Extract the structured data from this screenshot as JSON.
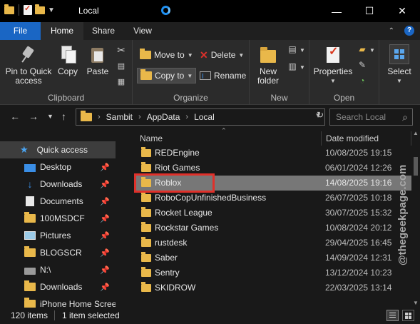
{
  "window": {
    "title": "Local",
    "minimize_glyph": "—",
    "maximize_glyph": "☐",
    "close_glyph": "✕"
  },
  "ribbon_tabs": [
    {
      "label": "File"
    },
    {
      "label": "Home"
    },
    {
      "label": "Share"
    },
    {
      "label": "View"
    }
  ],
  "ribbon": {
    "clipboard": {
      "group_label": "Clipboard",
      "pin_label_1": "Pin to Quick",
      "pin_label_2": "access",
      "copy_label": "Copy",
      "paste_label": "Paste"
    },
    "organize": {
      "group_label": "Organize",
      "move_to": "Move to",
      "copy_to": "Copy to",
      "delete": "Delete",
      "rename": "Rename"
    },
    "new": {
      "group_label": "New",
      "new_folder_1": "New",
      "new_folder_2": "folder"
    },
    "open": {
      "group_label": "Open",
      "properties": "Properties"
    },
    "select": {
      "label": "Select"
    }
  },
  "address": {
    "segments": [
      "Sambit",
      "AppData",
      "Local"
    ],
    "search_placeholder": "Search Local"
  },
  "nav_pane": {
    "quick_access": "Quick access",
    "items": [
      {
        "label": "Desktop",
        "icon": "desktop-icon"
      },
      {
        "label": "Downloads",
        "icon": "download-icon"
      },
      {
        "label": "Documents",
        "icon": "documents-icon"
      },
      {
        "label": "100MSDCF",
        "icon": "folder-icon"
      },
      {
        "label": "Pictures",
        "icon": "pictures-icon"
      },
      {
        "label": "BLOGSCR",
        "icon": "folder-icon"
      },
      {
        "label": "N:\\",
        "icon": "network-drive-icon"
      },
      {
        "label": "Downloads",
        "icon": "folder-icon"
      },
      {
        "label": "iPhone Home Scree",
        "icon": "folder-icon"
      }
    ]
  },
  "file_list": {
    "columns": {
      "name": "Name",
      "date_modified": "Date modified"
    },
    "rows": [
      {
        "name": "REDEngine",
        "date": "10/08/2025 19:15"
      },
      {
        "name": "Riot Games",
        "date": "06/01/2024 12:26"
      },
      {
        "name": "Roblox",
        "date": "14/08/2025 19:16",
        "selected": true
      },
      {
        "name": "RoboCopUnfinishedBusiness",
        "date": "26/07/2025 10:18"
      },
      {
        "name": "Rocket League",
        "date": "30/07/2025 15:32"
      },
      {
        "name": "Rockstar Games",
        "date": "10/08/2024 20:12"
      },
      {
        "name": "rustdesk",
        "date": "29/04/2025 16:45"
      },
      {
        "name": "Saber",
        "date": "14/09/2024 12:31"
      },
      {
        "name": "Sentry",
        "date": "13/12/2024 10:23"
      },
      {
        "name": "SKIDROW",
        "date": "22/03/2025 13:14"
      }
    ]
  },
  "status": {
    "item_count": "120 items",
    "selection": "1 item selected"
  },
  "watermark": "@thegeekpage.com",
  "colors": {
    "accent": "#1a66c4",
    "highlight_box": "#e0302a",
    "folder": "#e9b84a",
    "selected_row": "#777777"
  }
}
